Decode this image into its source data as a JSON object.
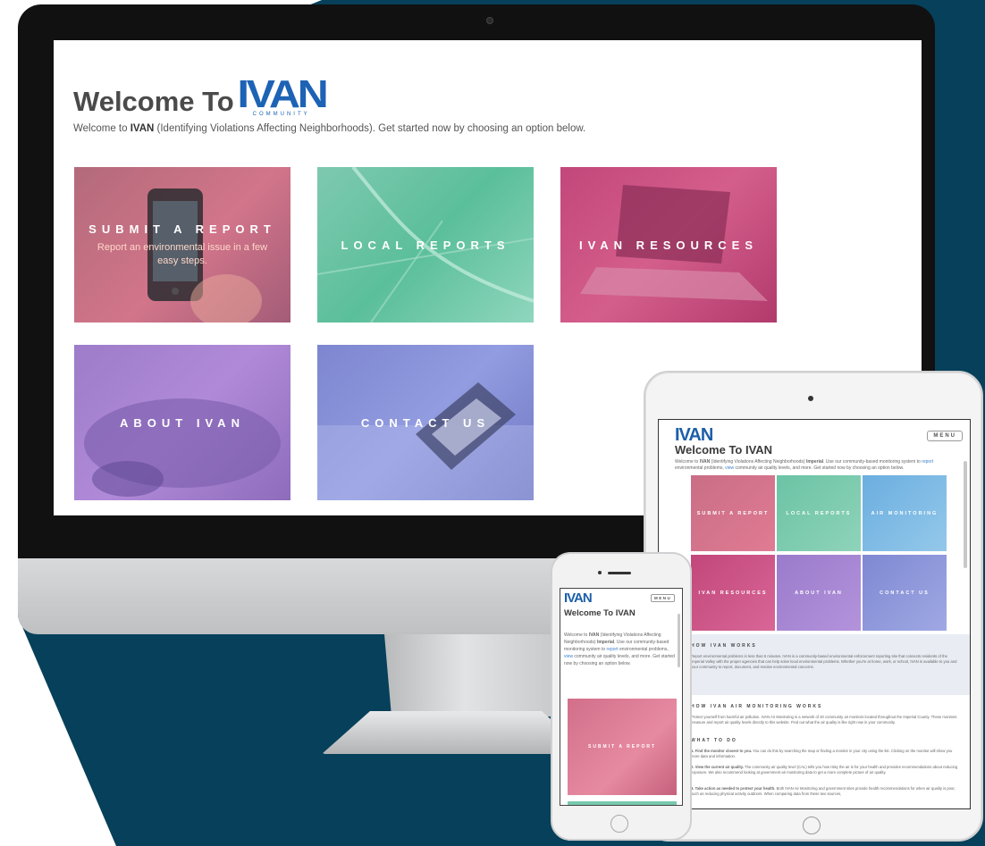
{
  "background": {
    "navy": "#06405a",
    "white": "#ffffff"
  },
  "desktop": {
    "title_text": "Welcome To",
    "logo_text": "IVAN",
    "logo_subtext": "COMMUNITY",
    "intro_prefix": "Welcome to ",
    "intro_bold": "IVAN",
    "intro_rest": " (Identifying Violations Affecting Neighborhoods). Get started now by choosing an option below.",
    "tiles": [
      {
        "label": "SUBMIT A REPORT",
        "subtitle": "Report an environmental issue in a few easy steps."
      },
      {
        "label": "LOCAL REPORTS",
        "subtitle": ""
      },
      {
        "label": "IVAN RESOURCES",
        "subtitle": ""
      },
      {
        "label": "ABOUT IVAN",
        "subtitle": ""
      },
      {
        "label": "CONTACT US",
        "subtitle": ""
      }
    ]
  },
  "tablet": {
    "logo_text": "IVAN",
    "menu_label": "MENU",
    "title": "Welcome To IVAN",
    "intro_a": "Welcome to ",
    "intro_b": "IVAN",
    "intro_c": " (Identifying Violations Affecting Neighborhoods) ",
    "intro_d": "Imperial",
    "intro_e": ". Use our community-based monitoring system to ",
    "intro_link1": "report",
    "intro_f": " environmental problems, ",
    "intro_link2": "view",
    "intro_g": " community air quality levels, and more. Get started now by choosing an option below.",
    "tiles": [
      {
        "label": "SUBMIT A REPORT"
      },
      {
        "label": "LOCAL REPORTS"
      },
      {
        "label": "AIR MONITORING"
      },
      {
        "label": "IVAN RESOURCES"
      },
      {
        "label": "ABOUT IVAN"
      },
      {
        "label": "CONTACT US"
      }
    ],
    "section1_heading": "HOW IVAN WORKS",
    "section1_text": "Report environmental problems in less than 5 minutes. IVAN is a community-based environmental enforcement reporting site that connects residents of the Imperial Valley with the proper agencies that can help solve local environmental problems. Whether you're at home, work, or school, IVAN is available to you and your community to report, document, and resolve environmental concerns.",
    "section2_heading": "HOW IVAN AIR MONITORING WORKS",
    "section2_text": "Protect yourself from harmful air pollution. IVAN Air Monitoring is a network of 40 community air monitors located throughout the Imperial County. These monitors measure and report air quality levels directly to this website. Find out what the air quality is like right now in your community.",
    "section3_heading": "WHAT TO DO",
    "step1_bold": "1. Find the monitor closest to you.",
    "step1_text": " You can do this by searching the map or finding a monitor in your city using the list. Clicking on the monitor will show you more data and information.",
    "step2_bold": "2. View the current air quality.",
    "step2_text": " The community air quality level (CAL) tells you how risky the air is for your health and provides recommendations about reducing exposure. We also recommend looking at government air monitoring data to get a more complete picture of air quality.",
    "step3_bold": "3. Take action as needed to protect your health.",
    "step3_text": " Both IVAN Air Monitoring and government sites provide health recommendations for when air quality is poor, such as reducing physical activity outdoors. When comparing data from these two sources,"
  },
  "phone": {
    "logo_text": "IVAN",
    "menu_label": "MENU",
    "title": "Welcome To IVAN",
    "intro_a": "Welcome to ",
    "intro_b": "IVAN",
    "intro_c": " (Identifying Violations Affecting Neighborhoods) ",
    "intro_d": "Imperial",
    "intro_e": ". Use our community-based monitoring system to ",
    "intro_link1": "report",
    "intro_f": " environmental problems, ",
    "intro_link2": "view",
    "intro_g": " community air quality levels, and more. Get started now by choosing an option below.",
    "tile_label": "SUBMIT A REPORT"
  }
}
